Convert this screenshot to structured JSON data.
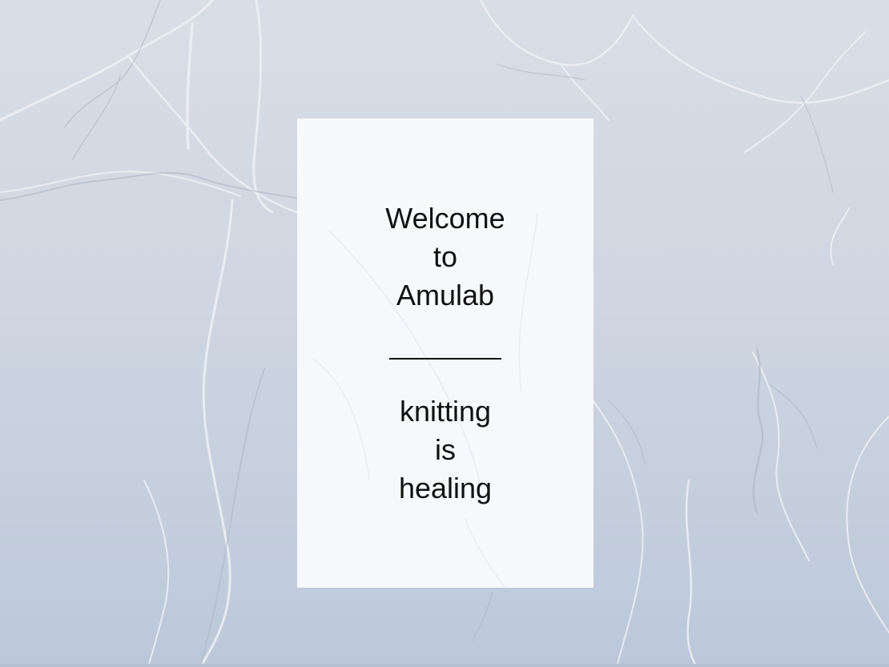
{
  "welcome": {
    "line1": "Welcome",
    "line2": "to",
    "line3": "Amulab"
  },
  "tagline": {
    "line1": "knitting",
    "line2": "is",
    "line3": "healing"
  },
  "colors": {
    "background": "#cfd6e1",
    "card": "#fafbfd",
    "text": "#111111"
  }
}
